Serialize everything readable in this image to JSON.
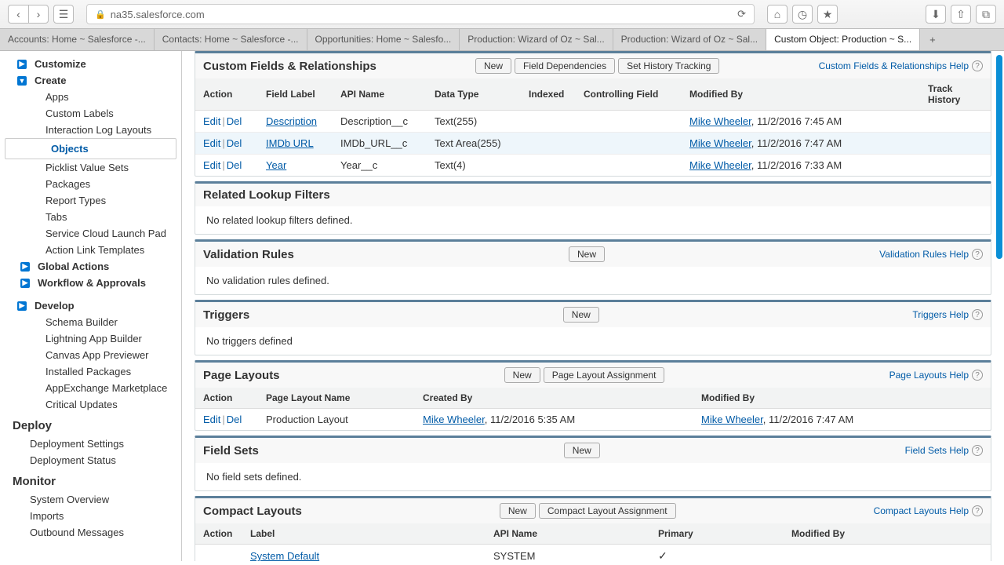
{
  "browser": {
    "url": "na35.salesforce.com",
    "tabs": [
      "Accounts: Home ~ Salesforce -...",
      "Contacts: Home ~ Salesforce -...",
      "Opportunities: Home ~ Salesfo...",
      "Production: Wizard of Oz ~ Sal...",
      "Production: Wizard of Oz ~ Sal...",
      "Custom Object: Production ~ S..."
    ]
  },
  "sidebar": {
    "customize": "Customize",
    "create": "Create",
    "create_items": [
      "Apps",
      "Custom Labels",
      "Interaction Log Layouts",
      "Objects",
      "Picklist Value Sets",
      "Packages",
      "Report Types",
      "Tabs",
      "Service Cloud Launch Pad",
      "Action Link Templates"
    ],
    "global_actions": "Global Actions",
    "workflow": "Workflow & Approvals",
    "develop": "Develop",
    "develop_items": [
      "Schema Builder",
      "Lightning App Builder",
      "Canvas App Previewer",
      "Installed Packages",
      "AppExchange Marketplace",
      "Critical Updates"
    ],
    "deploy": "Deploy",
    "deploy_items": [
      "Deployment Settings",
      "Deployment Status"
    ],
    "monitor": "Monitor",
    "monitor_items": [
      "System Overview",
      "Imports",
      "Outbound Messages"
    ]
  },
  "custom_fields": {
    "title": "Custom Fields & Relationships",
    "new": "New",
    "field_deps": "Field Dependencies",
    "history": "Set History Tracking",
    "help": "Custom Fields & Relationships Help",
    "headers": {
      "action": "Action",
      "label": "Field Label",
      "api": "API Name",
      "type": "Data Type",
      "indexed": "Indexed",
      "controlling": "Controlling Field",
      "modified": "Modified By",
      "track": "Track History"
    },
    "rows": [
      {
        "edit": "Edit",
        "del": "Del",
        "label": "Description",
        "api": "Description__c",
        "type": "Text(255)",
        "by": "Mike Wheeler",
        "date": ", 11/2/2016 7:45 AM"
      },
      {
        "edit": "Edit",
        "del": "Del",
        "label": "IMDb URL",
        "api": "IMDb_URL__c",
        "type": "Text Area(255)",
        "by": "Mike Wheeler",
        "date": ", 11/2/2016 7:47 AM"
      },
      {
        "edit": "Edit",
        "del": "Del",
        "label": "Year",
        "api": "Year__c",
        "type": "Text(4)",
        "by": "Mike Wheeler",
        "date": ", 11/2/2016 7:33 AM"
      }
    ]
  },
  "lookup": {
    "title": "Related Lookup Filters",
    "msg": "No related lookup filters defined."
  },
  "validation": {
    "title": "Validation Rules",
    "new": "New",
    "help": "Validation Rules Help",
    "msg": "No validation rules defined."
  },
  "triggers": {
    "title": "Triggers",
    "new": "New",
    "help": "Triggers Help",
    "msg": "No triggers defined"
  },
  "layouts": {
    "title": "Page Layouts",
    "new": "New",
    "assign": "Page Layout Assignment",
    "help": "Page Layouts Help",
    "headers": {
      "action": "Action",
      "name": "Page Layout Name",
      "created": "Created By",
      "modified": "Modified By"
    },
    "rows": [
      {
        "edit": "Edit",
        "del": "Del",
        "name": "Production Layout",
        "cby": "Mike Wheeler",
        "cdate": ", 11/2/2016 5:35 AM",
        "mby": "Mike Wheeler",
        "mdate": ", 11/2/2016 7:47 AM"
      }
    ]
  },
  "fieldsets": {
    "title": "Field Sets",
    "new": "New",
    "help": "Field Sets Help",
    "msg": "No field sets defined."
  },
  "compact": {
    "title": "Compact Layouts",
    "new": "New",
    "assign": "Compact Layout Assignment",
    "help": "Compact Layouts Help",
    "headers": {
      "action": "Action",
      "label": "Label",
      "api": "API Name",
      "primary": "Primary",
      "modified": "Modified By"
    },
    "rows": [
      {
        "label": "System Default",
        "api": "SYSTEM",
        "primary": "✓"
      }
    ]
  }
}
